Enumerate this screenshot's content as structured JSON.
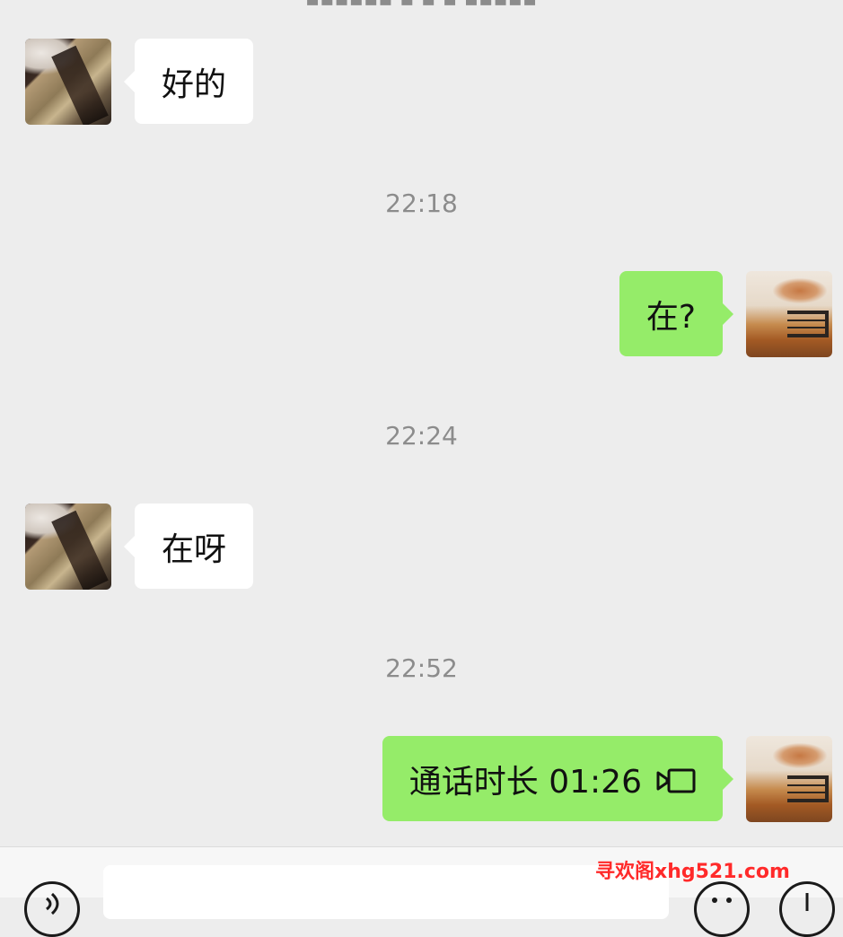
{
  "header": {
    "partial_text": "▪▪▪▪▪▪ ▪ ▪ ▪ ▪▪▪▪▪"
  },
  "messages": [
    {
      "side": "left",
      "text": "好的"
    },
    {
      "time": "22:18"
    },
    {
      "side": "right",
      "text": "在?"
    },
    {
      "time": "22:24"
    },
    {
      "side": "left",
      "text": "在呀"
    },
    {
      "time": "22:52"
    },
    {
      "side": "right",
      "text": "通话时长 01:26",
      "icon": "video-call-icon"
    }
  ],
  "input_bar": {
    "placeholder": ""
  },
  "watermark": "寻欢阁xhg521.com",
  "colors": {
    "background": "#ededed",
    "sent_bubble": "#95ec69",
    "received_bubble": "#ffffff",
    "timestamp": "#8c8c8c",
    "watermark": "#ff2a2a"
  }
}
